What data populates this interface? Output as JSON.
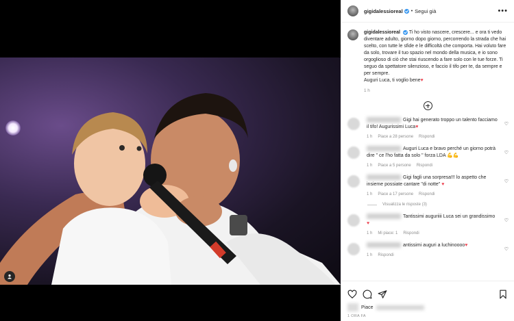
{
  "post": {
    "username": "gigidalessioreal",
    "follow_status": "Segui già",
    "caption": "Ti ho visto nascere, crescere... e ora ti vedo diventare adulto, giorno dopo giorno, percorrendo la strada che hai scelto, con tutte le sfide e le difficoltà che comporta. Hai voluto fare da solo, trovare il tuo spazio nel mondo della musica, e io sono orgoglioso di ciò che stai riuscendo a fare solo con le tue forze. Ti seguo da spettatore silenzioso, e faccio il tifo per te, da sempre e per sempre.\nAuguri Luca, ti voglio bene",
    "caption_time": "1 h"
  },
  "comments": [
    {
      "text": "Gigi hai generato troppo un talento facciamo il tifo! Augurissimi Luca",
      "time": "1 h",
      "likes": "Piace a 28 persone",
      "reply": "Rispondi"
    },
    {
      "text": "Auguri Luca e bravo perché un giorno potrà dire \" ce l'ho fatta da solo \" forza LDA",
      "time": "1 h",
      "likes": "Piace a 5 persone",
      "reply": "Rispondi"
    },
    {
      "text": "Gigi fagli una sorpresa!!! lo aspetto che insieme possiate cantare \"di notte\"",
      "time": "1 h",
      "likes": "Piace a 17 persone",
      "reply": "Rispondi",
      "view_replies": "Visualizza le risposte (3)"
    },
    {
      "text": "Tantissimi auguriiii Luca sei un grandissimo",
      "time": "1 h",
      "likes": "Mi piace: 1",
      "reply": "Rispondi"
    },
    {
      "text": "antissimi auguri a luchinoooo",
      "time": "1 h",
      "likes": "",
      "reply": "Rispondi"
    }
  ],
  "footer": {
    "likes_prefix": "Piace",
    "post_time": "1 ORA FA"
  },
  "icons": {
    "heart": "heart-icon",
    "comment": "comment-icon",
    "share": "share-icon",
    "save": "bookmark-icon",
    "more": "more-options-icon",
    "add": "add-circle-icon",
    "tag": "person-tag-icon"
  },
  "colors": {
    "verified": "#3897f0",
    "heart_red": "#ed4956",
    "meta_gray": "#8e8e8e"
  }
}
